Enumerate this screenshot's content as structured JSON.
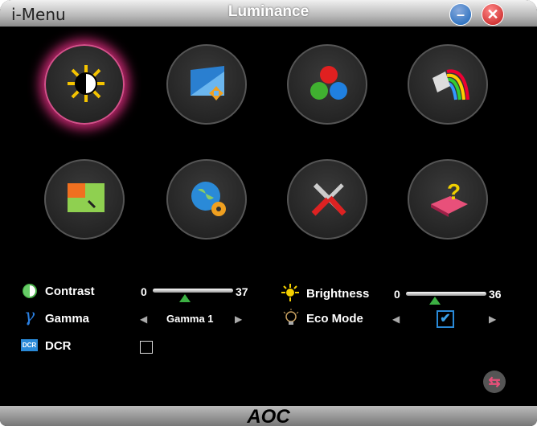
{
  "window": {
    "app_name": "i-Menu",
    "title": "Luminance",
    "logo": "AOC"
  },
  "menu_icons": [
    {
      "name": "luminance-icon",
      "selected": true
    },
    {
      "name": "image-setup-icon",
      "selected": false
    },
    {
      "name": "color-setup-icon",
      "selected": false
    },
    {
      "name": "picture-boost-icon",
      "selected": false
    },
    {
      "name": "osd-setup-icon",
      "selected": false
    },
    {
      "name": "extra-icon",
      "selected": false
    },
    {
      "name": "factory-reset-icon",
      "selected": false
    },
    {
      "name": "exit-icon",
      "selected": false
    }
  ],
  "settings": {
    "contrast": {
      "label": "Contrast",
      "min": "0",
      "value": "37",
      "fraction": 0.4
    },
    "brightness": {
      "label": "Brightness",
      "min": "0",
      "value": "36",
      "fraction": 0.36
    },
    "gamma": {
      "label": "Gamma",
      "value": "Gamma 1"
    },
    "eco": {
      "label": "Eco Mode",
      "checked": true
    },
    "dcr": {
      "label": "DCR",
      "icon_text": "DCR",
      "checked": false
    }
  },
  "colors": {
    "accent": "#c2276f",
    "slider_thumb": "#3cb043"
  }
}
